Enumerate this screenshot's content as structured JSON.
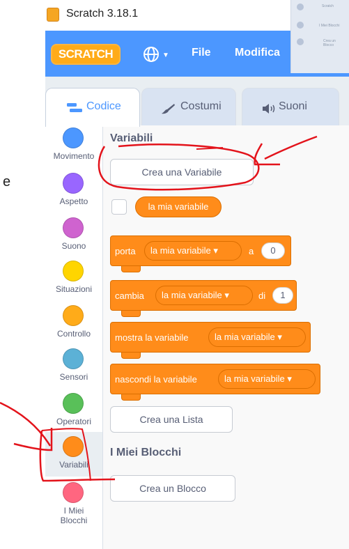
{
  "window": {
    "title": "Scratch 3.18.1"
  },
  "menubar": {
    "logo_text": "SCRATCH",
    "file_label": "File",
    "edit_label": "Modifica"
  },
  "taskbar_preview": {
    "items": [
      "Scratch",
      "I Miei Blocchi",
      "Crea un Blocco"
    ]
  },
  "tabs": {
    "code": "Codice",
    "costumes": "Costumi",
    "sounds": "Suoni"
  },
  "categories": [
    {
      "label": "Movimento",
      "color": "#4c97ff"
    },
    {
      "label": "Aspetto",
      "color": "#9966ff"
    },
    {
      "label": "Suono",
      "color": "#cf63cf"
    },
    {
      "label": "Situazioni",
      "color": "#ffd500"
    },
    {
      "label": "Controllo",
      "color": "#ffab19"
    },
    {
      "label": "Sensori",
      "color": "#5cb1d6"
    },
    {
      "label": "Operatori",
      "color": "#59c059"
    },
    {
      "label": "Variabili",
      "color": "#ff8c1a"
    },
    {
      "label": "I Miei Blocchi",
      "color": "#ff6680"
    }
  ],
  "palette": {
    "variables_heading": "Variabili",
    "make_variable_button": "Crea una Variabile",
    "variable_reporter": "la mia variabile",
    "set_block": {
      "verb": "porta",
      "variable": "la mia variabile",
      "prep": "a",
      "value": "0"
    },
    "change_block": {
      "verb": "cambia",
      "variable": "la mia variabile",
      "prep": "di",
      "value": "1"
    },
    "show_block": {
      "verb": "mostra la variabile",
      "variable": "la mia variabile"
    },
    "hide_block": {
      "verb": "nascondi la variabile",
      "variable": "la mia variabile"
    },
    "make_list_button": "Crea una Lista",
    "my_blocks_heading": "I Miei Blocchi",
    "make_block_button": "Crea un Blocco"
  },
  "edge_text": "e",
  "colors": {
    "accent_blue": "#4c97ff",
    "variables_orange": "#ff8c1a",
    "annotation_red": "#e3131b"
  }
}
